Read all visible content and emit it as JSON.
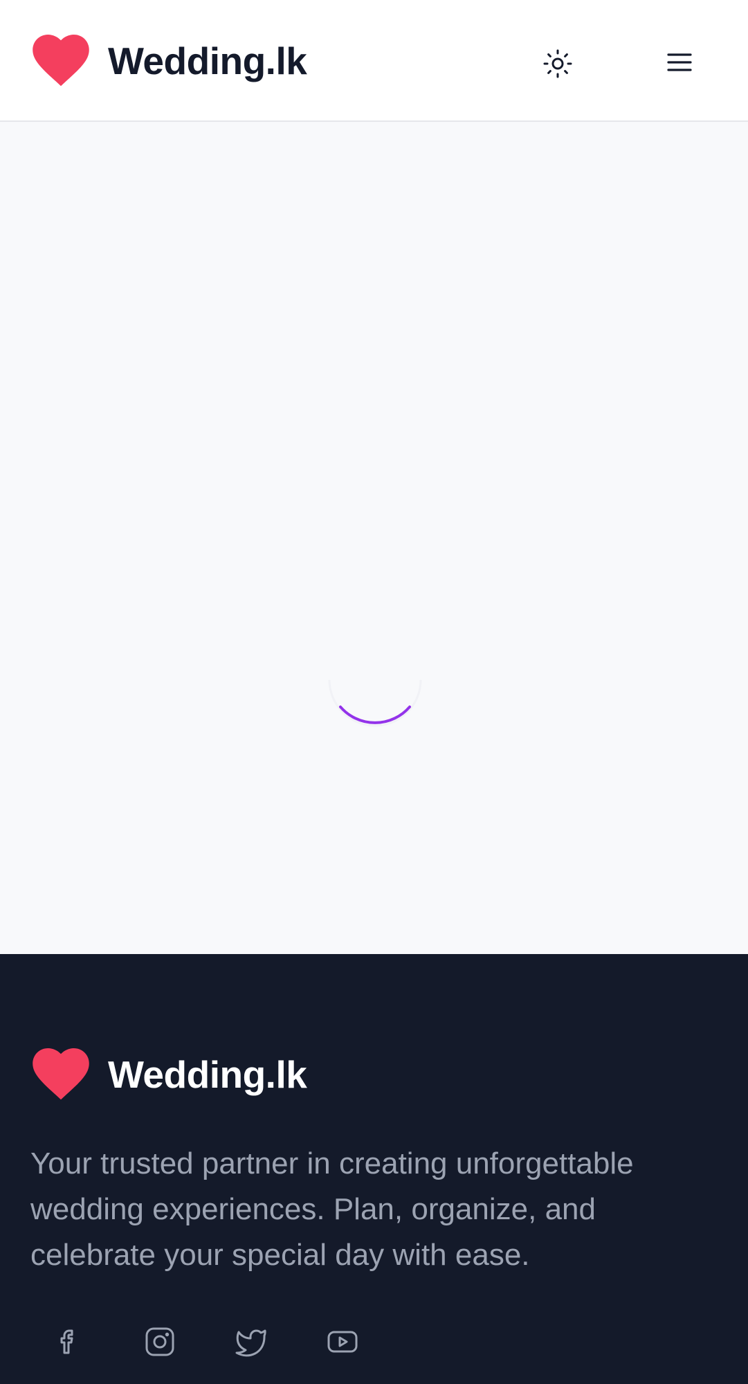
{
  "header": {
    "brand_name": "Wedding.lk",
    "logo_icon": "heart-icon",
    "theme_icon": "sun-icon",
    "menu_icon": "hamburger-menu-icon"
  },
  "main": {
    "loading_indicator": "spinner"
  },
  "footer": {
    "brand_name": "Wedding.lk",
    "tagline": "Your trusted partner in creating unforgettable wedding experiences. Plan, organize, and celebrate your special day with ease.",
    "social_icons": [
      "facebook-icon",
      "instagram-icon",
      "twitter-icon",
      "youtube-icon"
    ]
  },
  "colors": {
    "brand_heart": "#f43f5e",
    "header_text": "#141a2b",
    "footer_bg": "#141a2a",
    "footer_text": "#9ca3b2",
    "spinner": "#9333ea",
    "page_bg": "#f8f9fb"
  }
}
